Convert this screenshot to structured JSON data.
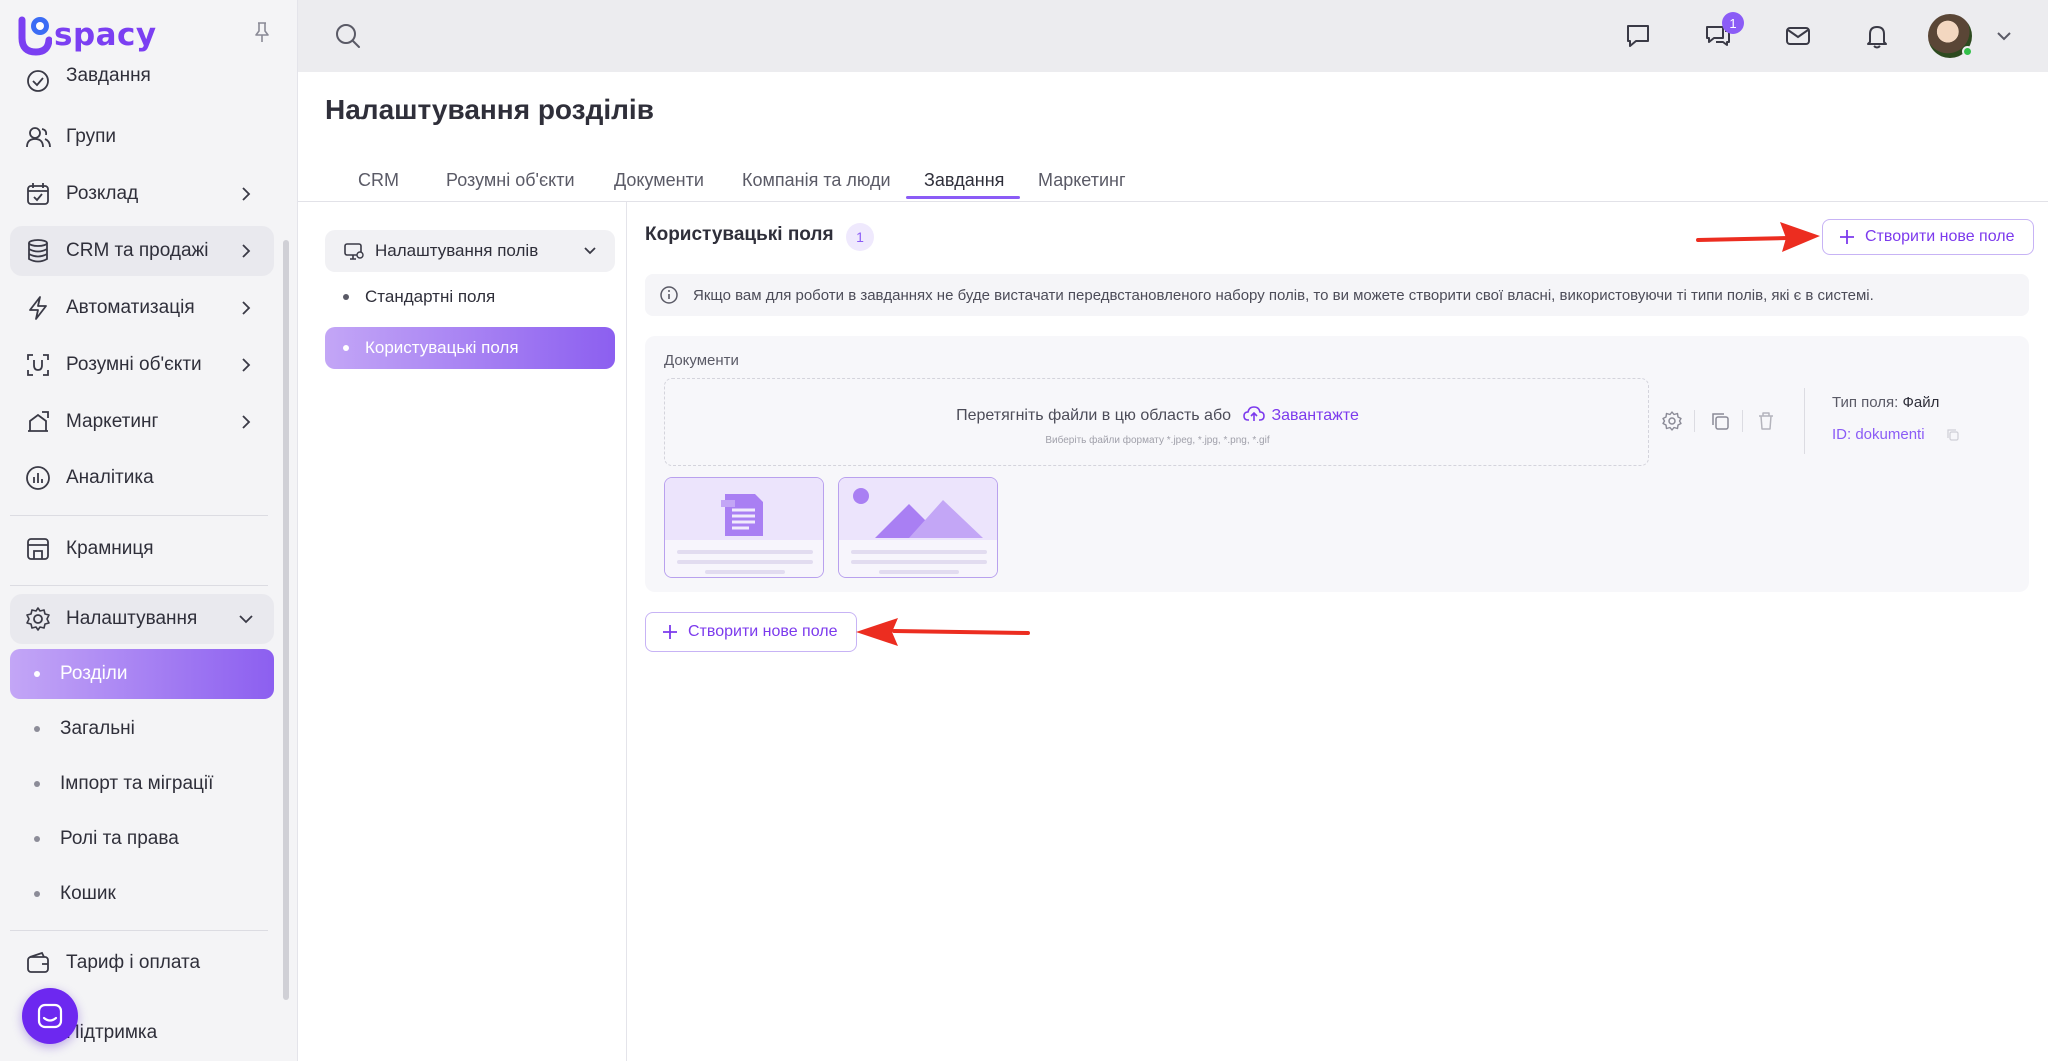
{
  "brand": {
    "logo_text": "spacy",
    "accent": "#8b5cf6"
  },
  "sidebar": {
    "items": [
      {
        "label": "Завдання",
        "icon": "check-circle-icon"
      },
      {
        "label": "Групи",
        "icon": "users-icon"
      },
      {
        "label": "Розклад",
        "icon": "calendar-icon"
      },
      {
        "label": "CRM та продажі",
        "icon": "database-icon"
      },
      {
        "label": "Автоматизація",
        "icon": "lightning-icon"
      },
      {
        "label": "Розумні об'єкти",
        "icon": "smart-object-icon"
      },
      {
        "label": "Маркетинг",
        "icon": "marketing-icon"
      },
      {
        "label": "Аналітика",
        "icon": "analytics-icon"
      },
      {
        "label": "Крамниця",
        "icon": "store-icon"
      },
      {
        "label": "Налаштування",
        "icon": "gear-icon"
      }
    ],
    "settings_sub": [
      {
        "label": "Розділи",
        "active": true
      },
      {
        "label": "Загальні"
      },
      {
        "label": "Імпорт та міграції"
      },
      {
        "label": "Ролі та права"
      },
      {
        "label": "Кошик"
      }
    ],
    "bottom": [
      {
        "label": "Тариф і оплата",
        "icon": "wallet-icon"
      },
      {
        "label": "Підтримка",
        "icon": "support-icon"
      }
    ]
  },
  "topbar": {
    "chat_badge": "1"
  },
  "page": {
    "title": "Налаштування розділів",
    "tabs": [
      {
        "label": "CRM"
      },
      {
        "label": "Розумні об'єкти"
      },
      {
        "label": "Документи"
      },
      {
        "label": "Компанія та люди"
      },
      {
        "label": "Завдання",
        "active": true
      },
      {
        "label": "Маркетинг"
      }
    ]
  },
  "left_panel": {
    "select_label": "Налаштування полів",
    "items": [
      {
        "label": "Стандартні поля"
      },
      {
        "label": "Користувацькі поля",
        "active": true
      }
    ]
  },
  "custom_fields": {
    "title": "Користувацькі поля",
    "count": "1",
    "create_label": "Створити нове поле",
    "info": "Якщо вам для роботи в завданнях не буде вистачати передвстановленого набору полів, то ви можете створити свої власні, використовуючи ті типи полів, які є в системі.",
    "field": {
      "label": "Документи",
      "drop_text": "Перетягніть файли в цю область або",
      "upload_label": "Завантажте",
      "hint": "Виберіть файли формату *.jpeg, *.jpg, *.png, *.gif",
      "type_label": "Тип поля:",
      "type_value": "Файл",
      "id_text": "ID: dokumenti"
    }
  }
}
